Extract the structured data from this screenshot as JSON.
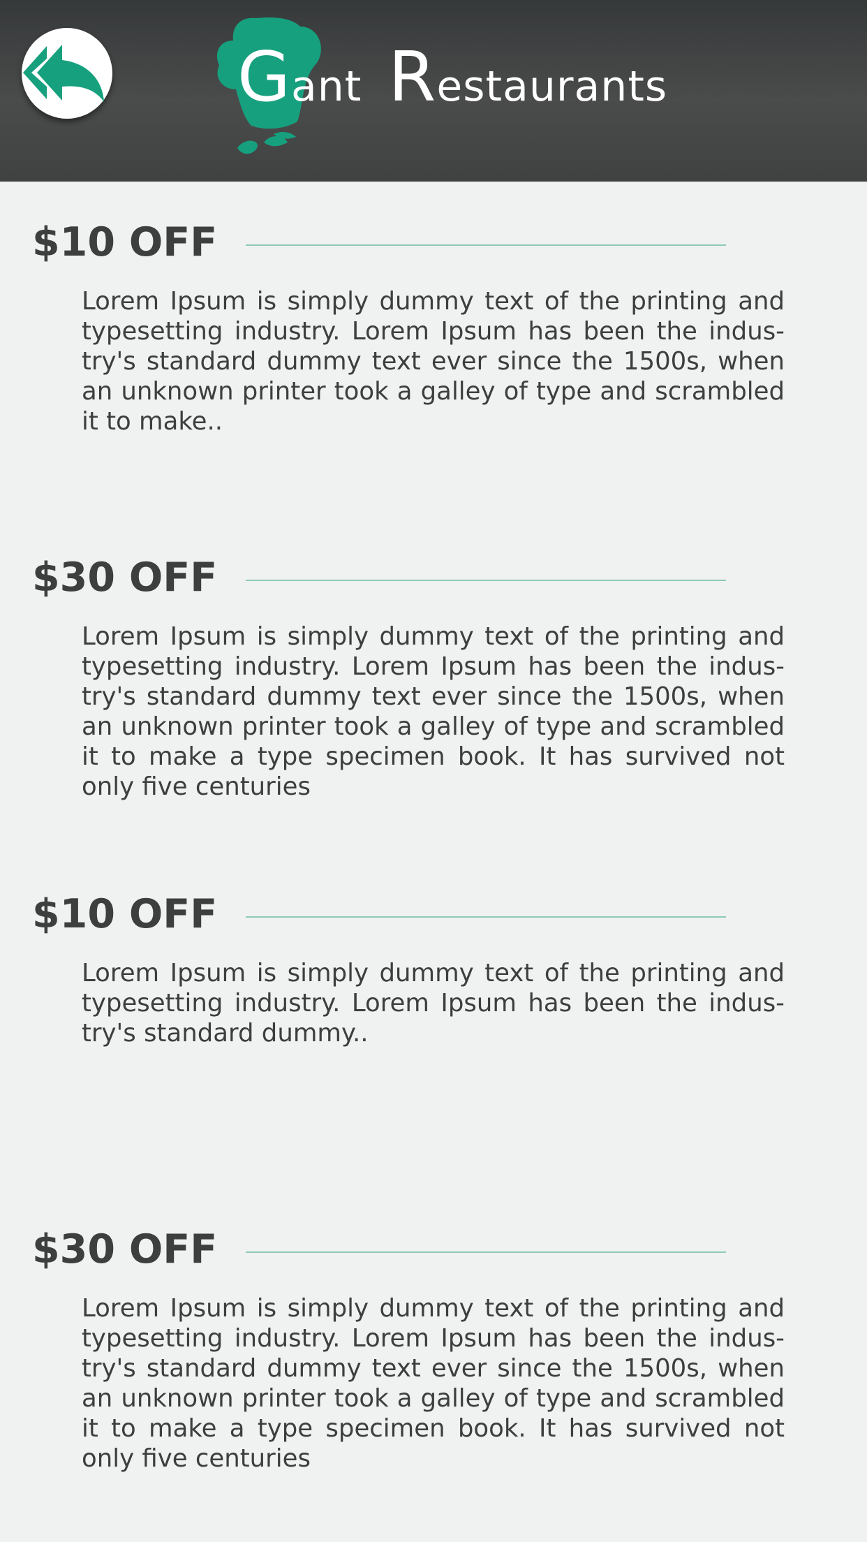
{
  "header": {
    "back_icon": "back-arrow-icon",
    "logo_icon": "chef-hat-icon",
    "brand_first_cap": "G",
    "brand_first_rest": "ant",
    "brand_second_cap": "R",
    "brand_second_rest": "estaurants",
    "brand_full": "Gant Restaurants",
    "colors": {
      "accent": "#16a07e",
      "header_bg": "#3f4141",
      "text": "#3d3f3f",
      "rule": "#8fcab4",
      "page_bg": "#f0f2f1"
    }
  },
  "offers": [
    {
      "title": "$10 OFF",
      "text": "Lorem Ipsum is simply dummy text of the printing and typesetting industry. Lorem Ipsum has been the indus-try's standard dummy text ever since the 1500s, when an unknown printer took a galley of type and scrambled it to make.."
    },
    {
      "title": "$30 OFF",
      "text": "Lorem Ipsum is simply dummy text of the printing and typesetting industry. Lorem Ipsum has been the indus-try's standard dummy text ever since the 1500s, when an unknown printer took a galley of type and scrambled it to make a type specimen book. It has survived not only five centuries"
    },
    {
      "title": "$10 OFF",
      "text": "Lorem Ipsum is simply dummy text of the printing and typesetting industry. Lorem Ipsum has been the indus-try's standard dummy.."
    },
    {
      "title": "$30 OFF",
      "text": "Lorem Ipsum is simply dummy text of the printing and typesetting industry. Lorem Ipsum has been the indus-try's standard dummy text ever since the 1500s, when an unknown printer took a galley of type and scrambled it to make a type specimen book. It has survived not only five centuries"
    }
  ]
}
